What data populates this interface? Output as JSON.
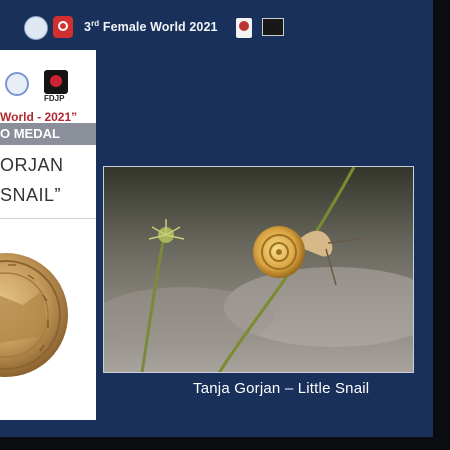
{
  "header": {
    "title_prefix": "3",
    "title_sup": "rd",
    "title_suffix": " Female World 2021"
  },
  "certificate": {
    "event": "World - 2021”",
    "medal_label": "O MEDAL",
    "author_partial": "ORJAN",
    "work_partial": "SNAIL”",
    "org_label": "FDJP"
  },
  "photo": {
    "caption": "Tanja Gorjan – Little Snail"
  },
  "colors": {
    "slide_background": "#19305a",
    "caption_text": "#ffffff",
    "event_text": "#b22830",
    "medal_bar": "#8a8f99",
    "gold_medal": "#c49a5a"
  },
  "icons": [
    "organization-logo-icon",
    "federation-logo-icon",
    "fdjp-logo-icon",
    "badge-logo-icon",
    "gold-medal-icon"
  ]
}
